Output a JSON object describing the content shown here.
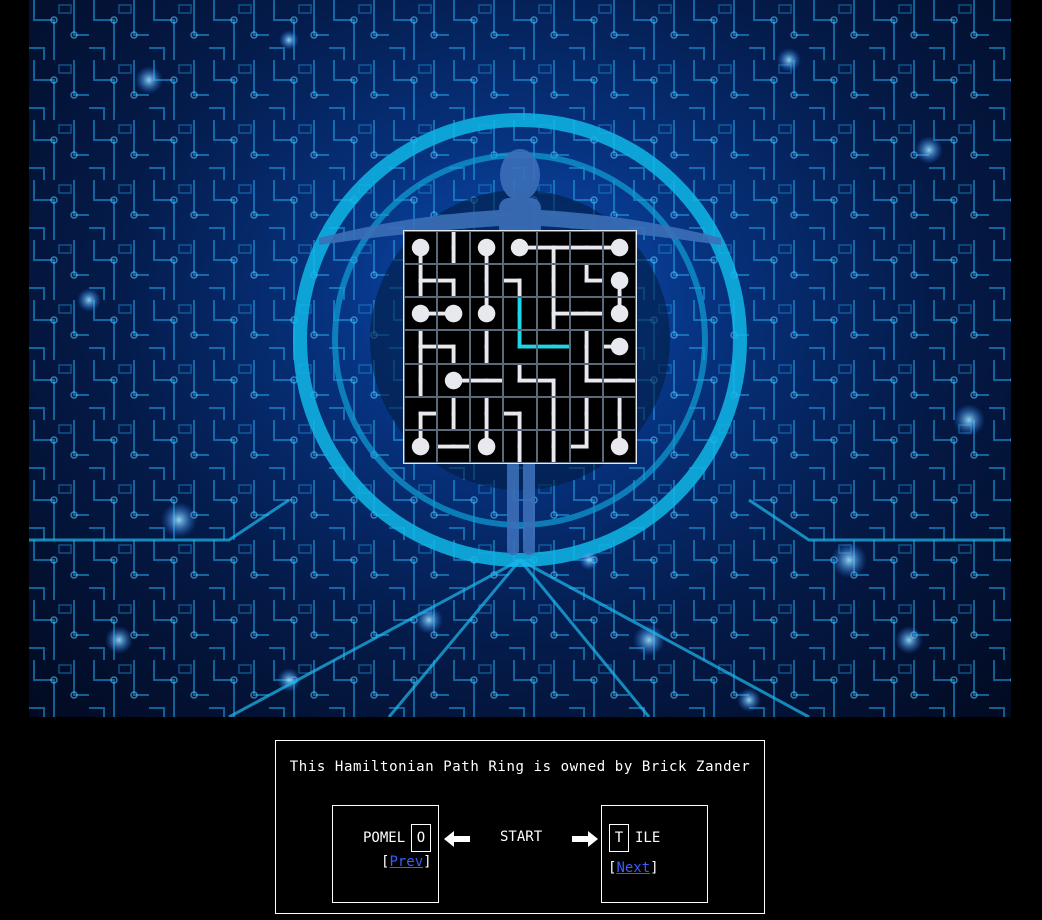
{
  "owner_text": "This Hamiltonian Path Ring is owned by Brick Zander",
  "prev_site": {
    "name": "POMEL",
    "letter": "O",
    "link_label": "Prev"
  },
  "next_site": {
    "name": "ILE",
    "letter": "T",
    "link_label": "Next"
  },
  "start_label": "START",
  "colors": {
    "background": "#000000",
    "grid_line": "#5a6a7a",
    "path": "#e8e8ef",
    "highlight": "#1fd6e6",
    "link": "#3b5bff"
  },
  "grid": {
    "rows": 7,
    "cols": 7,
    "cells": [
      [
        "dot-s",
        "v",
        "dot-s",
        "dot-e",
        "wes",
        "ew",
        "dot-w"
      ],
      [
        "nes",
        "ws",
        "ns",
        "sw-s",
        "ns",
        "ne",
        "dot-s"
      ],
      [
        "dot-e",
        "dot-w",
        "dot-n",
        "c-ns",
        "ens",
        "ew",
        "dot-n"
      ],
      [
        "nes",
        "sw",
        "ns",
        "c-ne",
        "c-ew",
        "ns",
        "dot-w"
      ],
      [
        "ns",
        "dot-e",
        "ew",
        "en",
        "ws",
        "ne",
        "ew"
      ],
      [
        "es",
        "ns",
        "ns",
        "sw",
        "ns",
        "ns",
        "ns"
      ],
      [
        "dot-n",
        "ew",
        "dot-n",
        "ns",
        "ns",
        "nw",
        "dot-n"
      ]
    ]
  }
}
